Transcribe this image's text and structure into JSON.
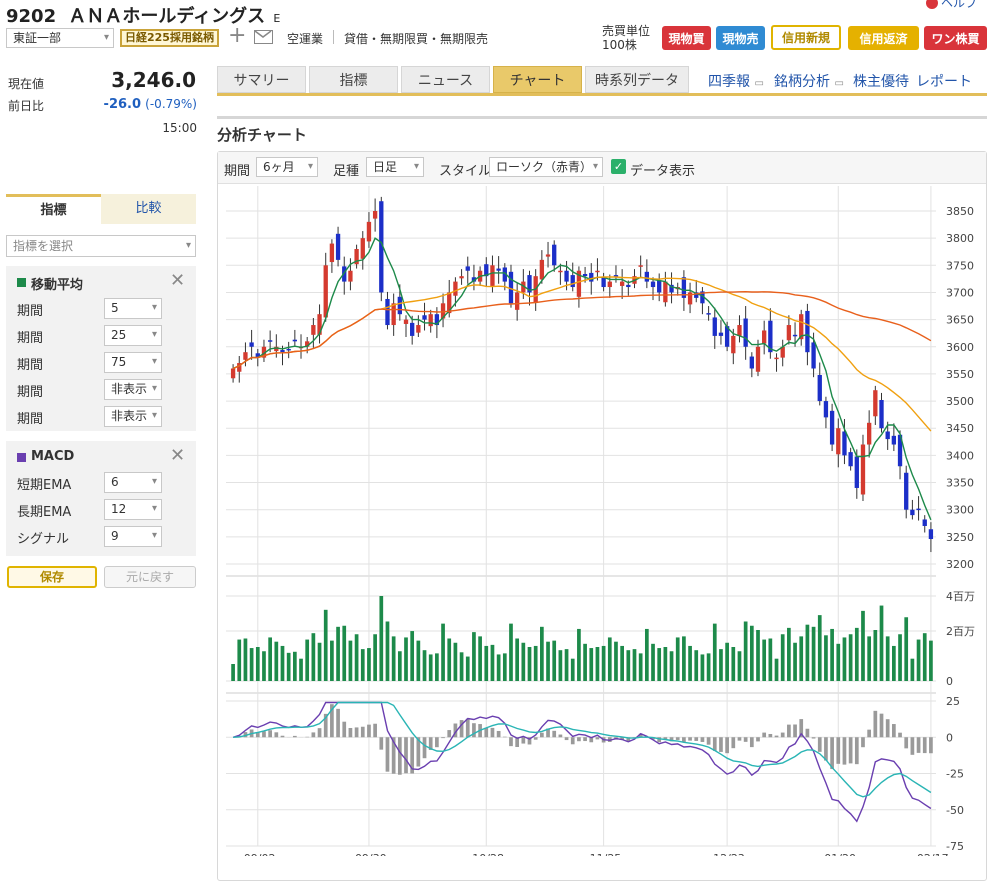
{
  "header": {
    "code": "9202",
    "name": "ＡＮＡホールディングス",
    "suffix": "E",
    "help_label": "ヘルプ",
    "market": "東証一部",
    "nikkei_badge": "日経225採用銘柄",
    "industry": "空運業",
    "margin_info": "貸借・無期限買・無期限売",
    "unit_label": "売買単位",
    "unit_value": "100株",
    "buttons": [
      "現物買",
      "現物売",
      "信用新規",
      "信用返済",
      "ワン株買"
    ]
  },
  "quote": {
    "price_label": "現在値",
    "price": "3,246.0",
    "change_label": "前日比",
    "change": "-26.0",
    "change_pct": "(-0.79%)",
    "time": "15:00"
  },
  "tabs": {
    "items": [
      "サマリー",
      "指標",
      "ニュース",
      "チャート",
      "時系列データ"
    ],
    "active": "チャート",
    "links": [
      "四季報",
      "銘柄分析",
      "株主優待",
      "レポート"
    ]
  },
  "chart_panel": {
    "title": "分析チャート",
    "period_label": "期間",
    "period_value": "6ヶ月",
    "foot_label": "足種",
    "foot_value": "日足",
    "style_label": "スタイル",
    "style_value": "ローソク（赤青）",
    "data_display_label": "データ表示",
    "data_display_checked": true
  },
  "sidebar": {
    "tab_indicator": "指標",
    "tab_compare": "比較",
    "select_placeholder": "指標を選択",
    "ma": {
      "title": "移動平均",
      "color": "#1d8a4a",
      "rows": [
        {
          "label": "期間",
          "value": "5"
        },
        {
          "label": "期間",
          "value": "25"
        },
        {
          "label": "期間",
          "value": "75"
        },
        {
          "label": "期間",
          "value": "非表示"
        },
        {
          "label": "期間",
          "value": "非表示"
        }
      ]
    },
    "macd": {
      "title": "MACD",
      "color": "#6a3fb0",
      "rows": [
        {
          "label": "短期EMA",
          "value": "6"
        },
        {
          "label": "長期EMA",
          "value": "12"
        },
        {
          "label": "シグナル",
          "value": "9"
        }
      ]
    },
    "save_label": "保存",
    "reset_label": "元に戻す"
  },
  "chart_data": {
    "type": "candlestick",
    "x_ticks": [
      "09/02",
      "09/30",
      "10/28",
      "11/25",
      "12/23",
      "01/20",
      "02/17"
    ],
    "price_axis": {
      "ticks": [
        3850,
        3800,
        3750,
        3700,
        3650,
        3600,
        3550,
        3500,
        3450,
        3400,
        3350,
        3300,
        3250,
        3200
      ],
      "range": [
        3200,
        3850
      ]
    },
    "volume_axis": {
      "ticks": [
        "4百万",
        "2百万",
        "0"
      ]
    },
    "macd_axis": {
      "ticks": [
        25,
        0,
        -25,
        -50,
        -75
      ],
      "range": [
        -75,
        25
      ]
    },
    "close": [
      3560,
      3570,
      3590,
      3600,
      3580,
      3600,
      3610,
      3600,
      3590,
      3595,
      3610,
      3600,
      3610,
      3640,
      3660,
      3750,
      3790,
      3760,
      3720,
      3740,
      3780,
      3800,
      3830,
      3850,
      3700,
      3640,
      3680,
      3660,
      3650,
      3620,
      3640,
      3650,
      3660,
      3640,
      3680,
      3700,
      3720,
      3730,
      3740,
      3720,
      3740,
      3730,
      3750,
      3740,
      3720,
      3680,
      3700,
      3720,
      3700,
      3730,
      3760,
      3770,
      3750,
      3740,
      3720,
      3710,
      3740,
      3730,
      3720,
      3740,
      3710,
      3720,
      3730,
      3720,
      3710,
      3730,
      3750,
      3720,
      3710,
      3700,
      3720,
      3700,
      3710,
      3690,
      3700,
      3690,
      3680,
      3660,
      3620,
      3620,
      3600,
      3620,
      3640,
      3600,
      3560,
      3600,
      3630,
      3590,
      3580,
      3600,
      3640,
      3620,
      3660,
      3590,
      3560,
      3500,
      3470,
      3420,
      3450,
      3400,
      3380,
      3340,
      3420,
      3460,
      3520,
      3450,
      3430,
      3420,
      3380,
      3300,
      3290,
      3300,
      3270,
      3246
    ],
    "ma_series": [
      {
        "name": "MA5",
        "period": 5,
        "color": "#1d8a4a"
      },
      {
        "name": "MA25",
        "period": 25,
        "color": "#f0a010"
      },
      {
        "name": "MA75",
        "period": 75,
        "color": "#e8601c"
      }
    ],
    "macd_series": [
      {
        "name": "MACD",
        "color": "#6a3fb0"
      },
      {
        "name": "Signal",
        "color": "#2ab5b5"
      }
    ],
    "colors": {
      "up": "#d43a2f",
      "down": "#1c2fc8",
      "volume": "#1d8a4a",
      "histogram": "#9a9a9a"
    }
  }
}
